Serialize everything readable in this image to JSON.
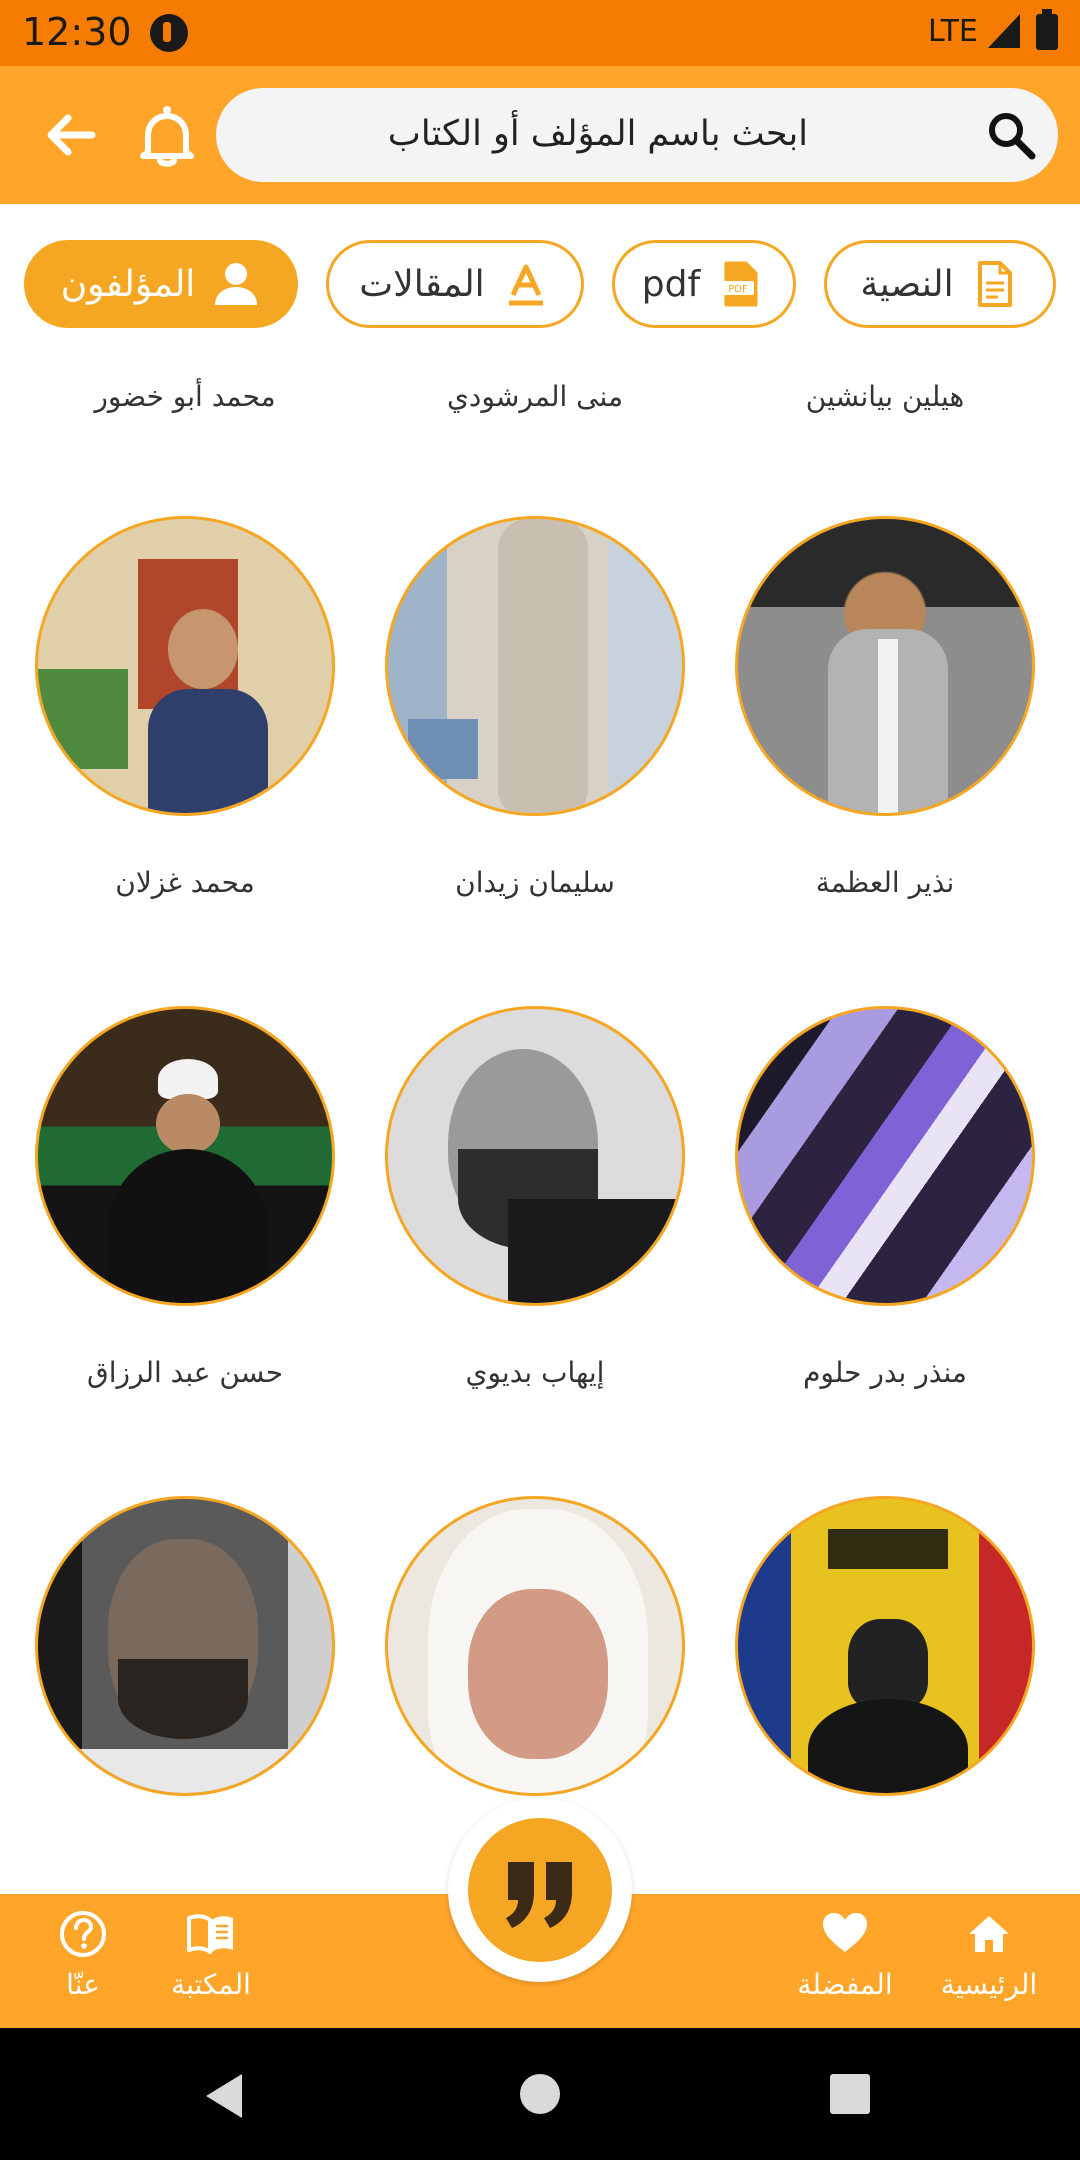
{
  "status_bar": {
    "time": "12:30",
    "network": "LTE"
  },
  "search": {
    "placeholder": "ابحث باسم المؤلف أو الكتاب"
  },
  "filters": [
    {
      "label": "النصية",
      "icon": "document-icon",
      "active": false
    },
    {
      "label": "pdf",
      "icon": "pdf-icon",
      "active": false
    },
    {
      "label": "المقالات",
      "icon": "font-icon",
      "active": false
    },
    {
      "label": "المؤلفون",
      "icon": "person-icon",
      "active": true
    }
  ],
  "authors_top_row": [
    {
      "name": "هيلين بيانشين"
    },
    {
      "name": "منى المرشودي"
    },
    {
      "name": "محمد أبو خضور"
    }
  ],
  "authors": [
    {
      "name": "نذير العظمة"
    },
    {
      "name": "سليمان زيدان"
    },
    {
      "name": "محمد غزلان"
    },
    {
      "name": "منذر بدر حلوم"
    },
    {
      "name": "إيهاب بديوي"
    },
    {
      "name": "حسن عبد الرزاق"
    },
    {
      "name": ""
    },
    {
      "name": ""
    },
    {
      "name": ""
    }
  ],
  "bottom_nav": {
    "home": "الرئيسية",
    "favorites": "المفضلة",
    "library": "المكتبة",
    "about": "عنّا"
  },
  "colors": {
    "primary": "#FFA52A",
    "accent": "#F5A623",
    "status_bar": "#F57C00"
  }
}
